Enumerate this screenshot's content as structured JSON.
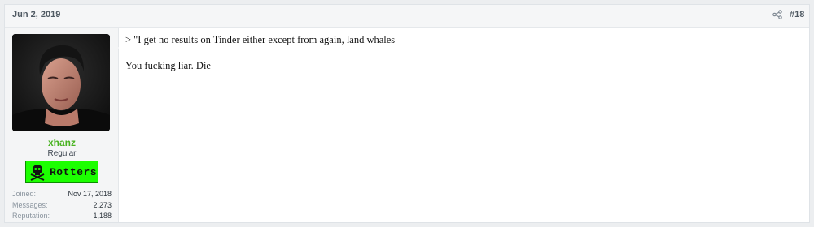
{
  "post": {
    "date": "Jun 2, 2019",
    "number": "#18"
  },
  "user": {
    "name": "xhanz",
    "title": "Regular",
    "banner": "Rotters",
    "stats": [
      {
        "label": "Joined:",
        "value": "Nov 17, 2018"
      },
      {
        "label": "Messages:",
        "value": "2,273"
      },
      {
        "label": "Reputation:",
        "value": "1,188"
      }
    ]
  },
  "message": {
    "quote_line": "> \"I get no results on Tinder either except from again, land whales",
    "reply_line": "You fucking liar. Die"
  },
  "colors": {
    "username": "#49b321",
    "banner_bg": "#1cff00",
    "page_bg": "#eceef0"
  }
}
